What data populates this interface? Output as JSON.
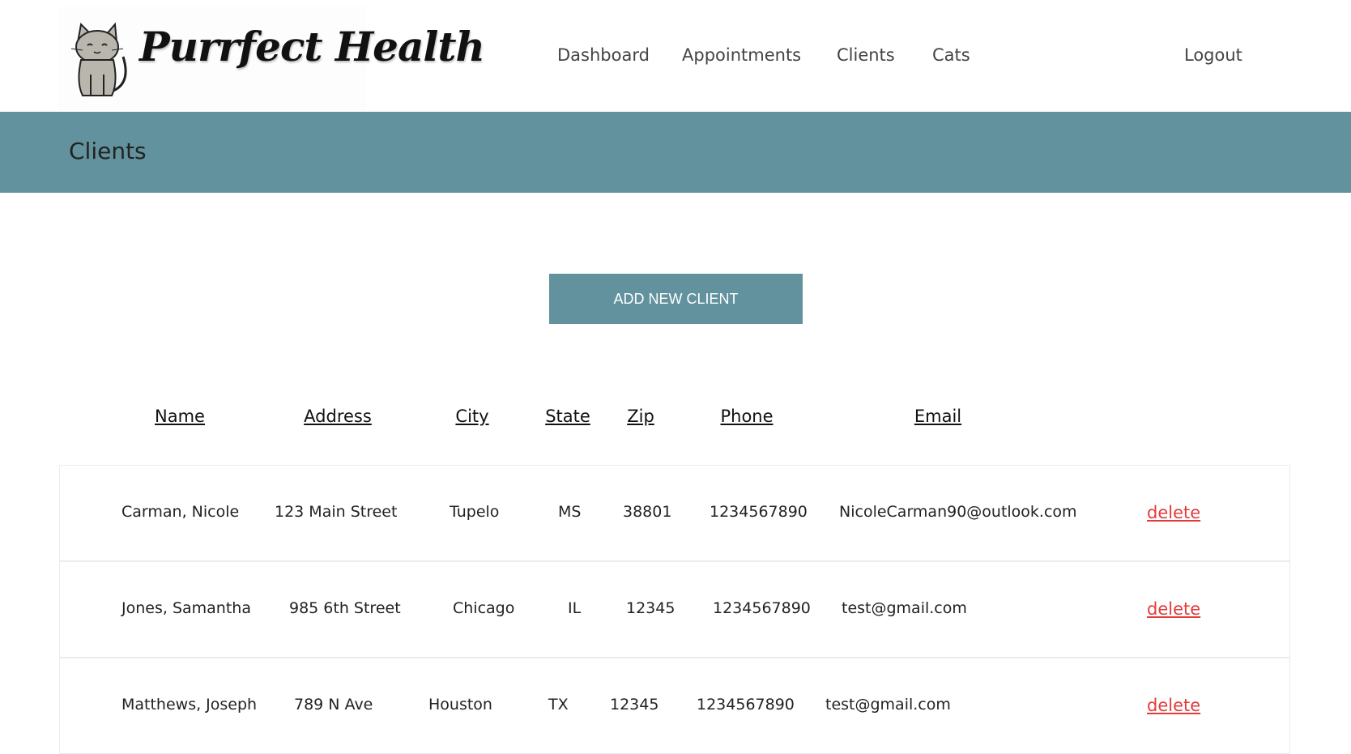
{
  "header": {
    "logo_text": "Purrfect Health",
    "nav": [
      {
        "label": "Dashboard"
      },
      {
        "label": "Appointments"
      },
      {
        "label": "Clients"
      },
      {
        "label": "Cats"
      }
    ],
    "logout_label": "Logout"
  },
  "banner": {
    "title": "Clients"
  },
  "actions": {
    "add_label": "ADD NEW CLIENT"
  },
  "table": {
    "columns": [
      "Name",
      "Address",
      "City",
      "State",
      "Zip",
      "Phone",
      "Email"
    ],
    "rows": [
      {
        "name": "Carman, Nicole",
        "address": "123 Main Street",
        "city": "Tupelo",
        "state": "MS",
        "zip": "38801",
        "phone": "1234567890",
        "email": "NicoleCarman90@outlook.com",
        "delete": "delete"
      },
      {
        "name": "Jones, Samantha",
        "address": "985 6th Street",
        "city": "Chicago",
        "state": "IL",
        "zip": "12345",
        "phone": "1234567890",
        "email": "test@gmail.com",
        "delete": "delete"
      },
      {
        "name": "Matthews, Joseph",
        "address": "789 N Ave",
        "city": "Houston",
        "state": "TX",
        "zip": "12345",
        "phone": "1234567890",
        "email": "test@gmail.com",
        "delete": "delete"
      }
    ]
  },
  "colors": {
    "accent": "#62929e",
    "delete": "#e33b3b"
  }
}
